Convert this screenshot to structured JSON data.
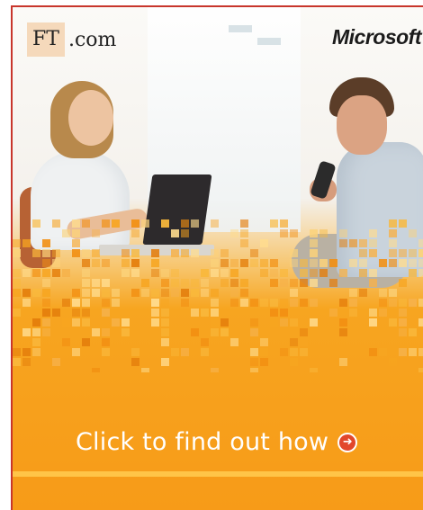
{
  "ad": {
    "brand_left": {
      "ft": "FT",
      "com": ".com"
    },
    "brand_right": "Microsoft",
    "cta_label": "Click to find out how",
    "colors": {
      "accent_orange": "#f79b18",
      "border_red": "#c8362c",
      "arrow_red": "#e2472b"
    },
    "icons": {
      "cta_arrow": "arrow-right-circle-icon"
    }
  }
}
